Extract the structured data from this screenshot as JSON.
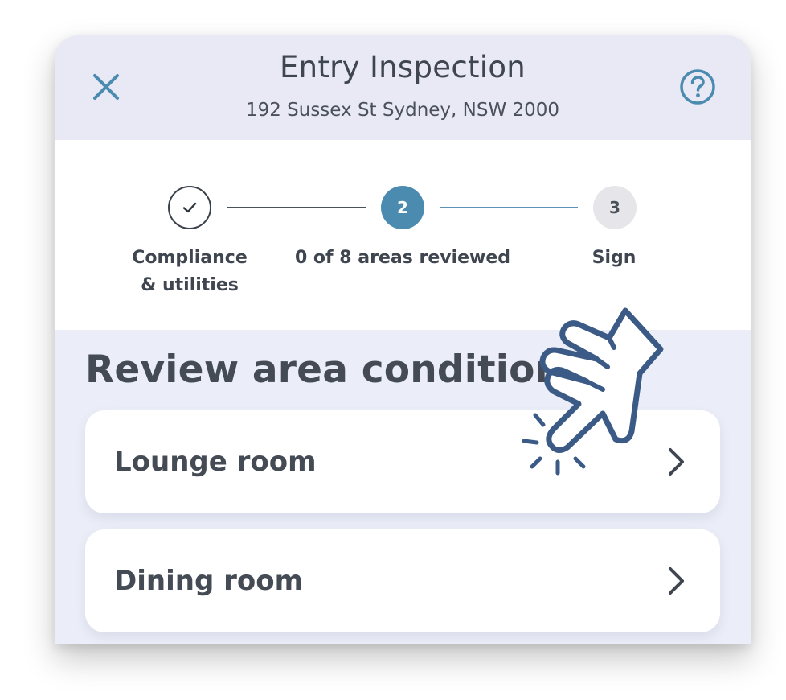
{
  "header": {
    "title": "Entry Inspection",
    "address": "192 Sussex St Sydney, NSW 2000",
    "close_icon": "close-icon",
    "help_icon": "help-icon"
  },
  "stepper": {
    "steps": [
      {
        "badge": "",
        "icon": "checkmark-icon",
        "label_line1": "Compliance",
        "label_line2": "& utilities",
        "state": "completed"
      },
      {
        "badge": "2",
        "label": "0 of 8 areas reviewed",
        "state": "current"
      },
      {
        "badge": "3",
        "label": "Sign",
        "state": "upcoming"
      }
    ]
  },
  "section": {
    "title": "Review area condition"
  },
  "areas": [
    {
      "label": "Lounge room",
      "icon": "chevron-right-icon"
    },
    {
      "label": "Dining room",
      "icon": "chevron-right-icon"
    }
  ],
  "overlay": {
    "icon": "tap-hand-icon"
  },
  "colors": {
    "header_bg": "#e8e9f5",
    "accent_blue": "#4b8bb0",
    "text_dark": "#3f4650",
    "page_bg": "#ebeef8"
  }
}
